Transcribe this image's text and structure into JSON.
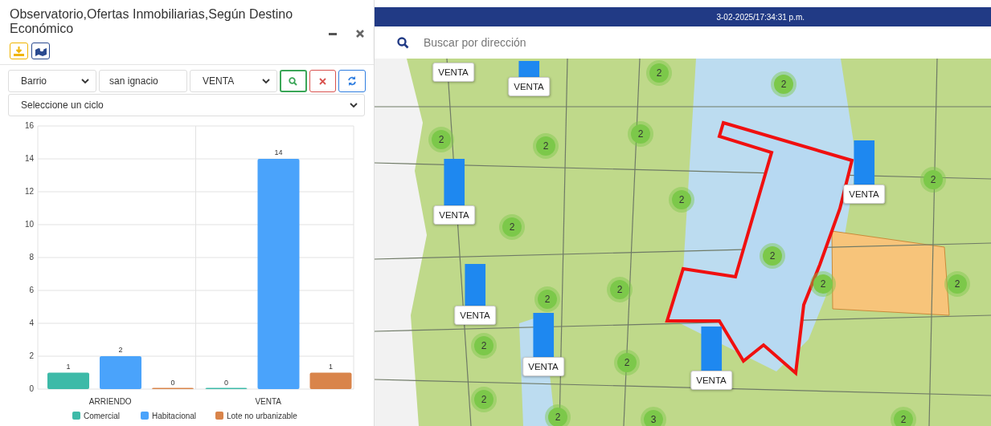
{
  "panel": {
    "title": "Observatorio,Ofertas Inmobiliarias,Según Destino Económico",
    "filters": {
      "zone_type": "Barrio",
      "zone_value": "san ignacio",
      "operation": "VENTA",
      "cycle_placeholder": "Seleccione un ciclo"
    },
    "chart_data": {
      "type": "bar",
      "categories": [
        "ARRIENDO",
        "VENTA"
      ],
      "series": [
        {
          "name": "Comercial",
          "color": "#3dbaa8",
          "values": [
            1,
            0
          ]
        },
        {
          "name": "Habitacional",
          "color": "#4aa3fb",
          "values": [
            2,
            14
          ]
        },
        {
          "name": "Lote no urbanizable",
          "color": "#d9844a",
          "values": [
            0,
            1
          ]
        }
      ],
      "ylim": [
        0,
        16
      ],
      "yticks": [
        0,
        2,
        4,
        6,
        8,
        10,
        12,
        14,
        16
      ],
      "data_labels": true,
      "grid": true,
      "legend": true
    }
  },
  "header": {
    "timestamp": "3-02-2025/17:34:31 p.m."
  },
  "search": {
    "placeholder": "Buscar por dirección"
  },
  "map": {
    "clusters": [
      {
        "count": "2"
      },
      {
        "count": "2"
      },
      {
        "count": "2"
      },
      {
        "count": "2"
      },
      {
        "count": "2"
      },
      {
        "count": "2"
      },
      {
        "count": "2"
      },
      {
        "count": "2"
      },
      {
        "count": "2"
      },
      {
        "count": "2"
      },
      {
        "count": "2"
      },
      {
        "count": "2"
      },
      {
        "count": "2"
      },
      {
        "count": "2"
      },
      {
        "count": "2"
      },
      {
        "count": "2"
      },
      {
        "count": "2"
      },
      {
        "count": "3"
      },
      {
        "count": "2"
      }
    ],
    "labels": [
      {
        "text": "VENTA"
      },
      {
        "text": "VENTA"
      },
      {
        "text": "VENTA"
      },
      {
        "text": "VENTA"
      },
      {
        "text": "VENTA"
      },
      {
        "text": "VENTA"
      },
      {
        "text": "VENTA"
      }
    ]
  }
}
